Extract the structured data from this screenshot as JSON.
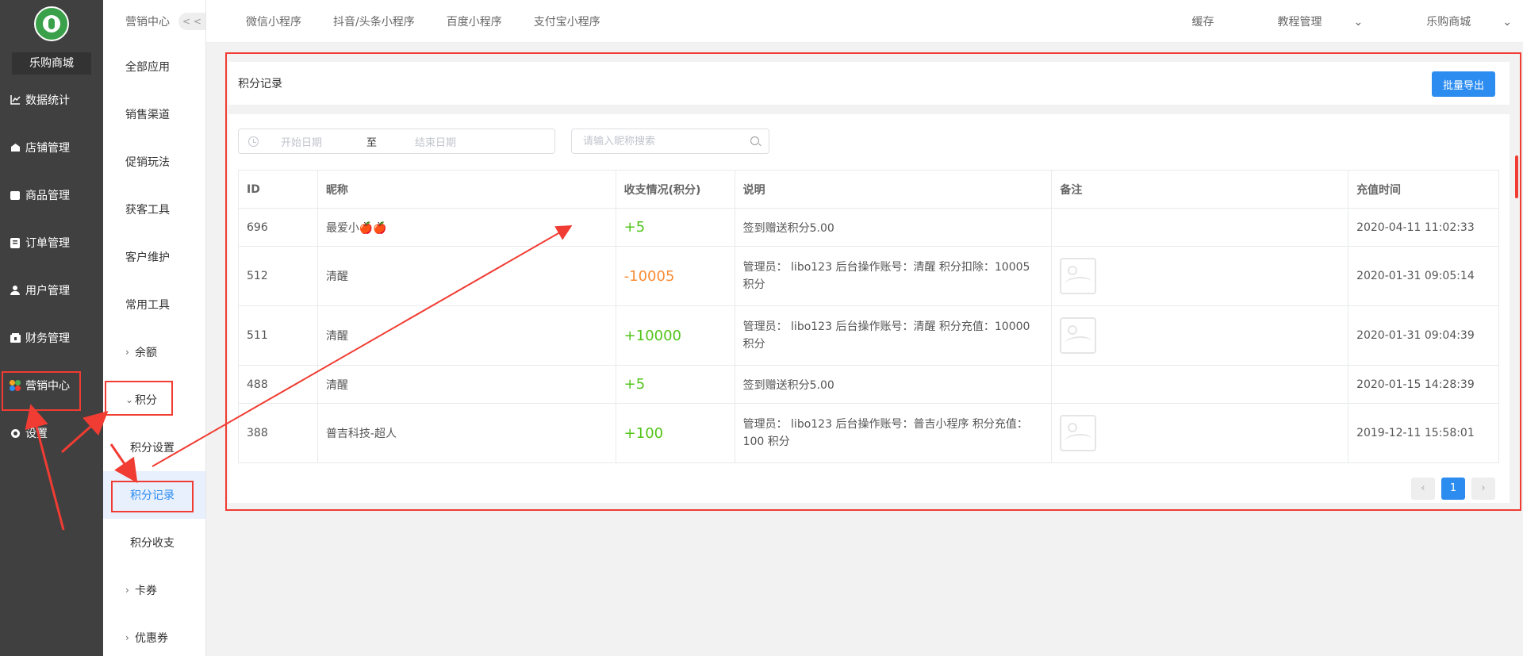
{
  "sidebar": {
    "shop_name": "乐购商城",
    "items": [
      {
        "label": "数据统计",
        "icon": "chart-icon"
      },
      {
        "label": "店铺管理",
        "icon": "store-icon"
      },
      {
        "label": "商品管理",
        "icon": "goods-icon"
      },
      {
        "label": "订单管理",
        "icon": "order-icon"
      },
      {
        "label": "用户管理",
        "icon": "user-icon"
      },
      {
        "label": "财务管理",
        "icon": "finance-icon"
      },
      {
        "label": "营销中心",
        "icon": "marketing-icon"
      },
      {
        "label": "设置",
        "icon": "gear-icon"
      }
    ]
  },
  "subnav": {
    "header": "营销中心",
    "collapse": "< <",
    "items": [
      "全部应用",
      "销售渠道",
      "促销玩法",
      "获客工具",
      "客户维护",
      "常用工具",
      "余额",
      "积分"
    ],
    "children": [
      "积分设置",
      "积分记录",
      "积分收支"
    ],
    "after": [
      "卡券",
      "优惠券"
    ]
  },
  "topbar": {
    "tabs": [
      "微信小程序",
      "抖音/头条小程序",
      "百度小程序",
      "支付宝小程序"
    ],
    "right": [
      "缓存",
      "教程管理",
      "乐购商城"
    ]
  },
  "panel": {
    "title": "积分记录",
    "export_label": "批量导出"
  },
  "filters": {
    "start_placeholder": "开始日期",
    "sep": "至",
    "end_placeholder": "结束日期",
    "search_placeholder": "请输入昵称搜索"
  },
  "table": {
    "headers": [
      "ID",
      "昵称",
      "收支情况(积分)",
      "说明",
      "备注",
      "充值时间"
    ],
    "rows": [
      {
        "id": "696",
        "nickname": "最爱小🍎🍎",
        "change": "+5",
        "desc": "签到赠送积分5.00",
        "time": "2020-04-11 11:02:33"
      },
      {
        "id": "512",
        "nickname": "清醒",
        "change": "-10005",
        "desc": "管理员： libo123 后台操作账号：清醒 积分扣除：10005 积分",
        "time": "2020-01-31 09:05:14"
      },
      {
        "id": "511",
        "nickname": "清醒",
        "change": "+10000",
        "desc": "管理员： libo123 后台操作账号：清醒 积分充值：10000 积分",
        "time": "2020-01-31 09:04:39"
      },
      {
        "id": "488",
        "nickname": "清醒",
        "change": "+5",
        "desc": "签到赠送积分5.00",
        "time": "2020-01-15 14:28:39"
      },
      {
        "id": "388",
        "nickname": "普吉科技-超人",
        "change": "+100",
        "desc": "管理员： libo123 后台操作账号：普吉小程序 积分充值：100 积分",
        "time": "2019-12-11 15:58:01"
      }
    ]
  },
  "pagination": {
    "prev": "‹",
    "current": "1",
    "next": "›"
  },
  "colors": {
    "primary": "#2d8cf0",
    "positive": "#52c41a",
    "negative": "#fa8c35",
    "annotation": "#f03c32"
  }
}
